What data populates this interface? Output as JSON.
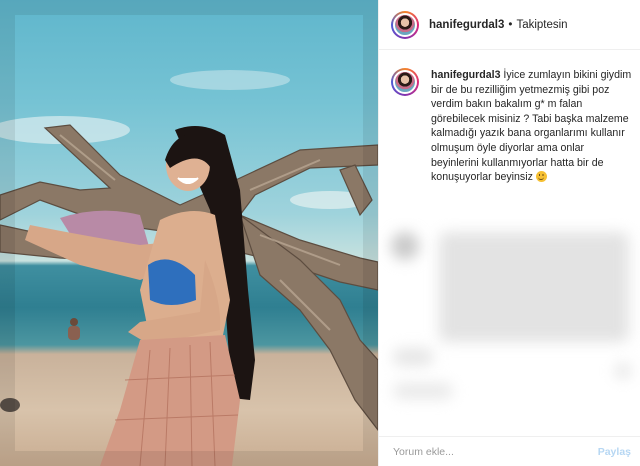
{
  "post": {
    "username": "hanifegurdal3",
    "separator": "•",
    "follow_status": "Takiptesin"
  },
  "caption": {
    "username": "hanifegurdal3",
    "text": "İyice zumlayın bikini giydim bir de bu rezilliğim yetmezmiş gibi poz verdim bakın bakalım g* m     falan görebilecek misiniz ? Tabi başka malzeme kalmadığı yazık bana organlarımı kullanır olmuşum öyle diyorlar ama onlar beyinlerini kullanmıyorlar hatta bir de konuşuyorlar beyinsiz",
    "emoji_icon": "smiley-face-icon"
  },
  "comment_box": {
    "placeholder": "Yorum ekle...",
    "share_label": "Paylaş"
  },
  "colors": {
    "share_disabled": "#b7d7f3",
    "divider": "#efefef",
    "text": "#262626",
    "placeholder": "#9a9a9a"
  }
}
